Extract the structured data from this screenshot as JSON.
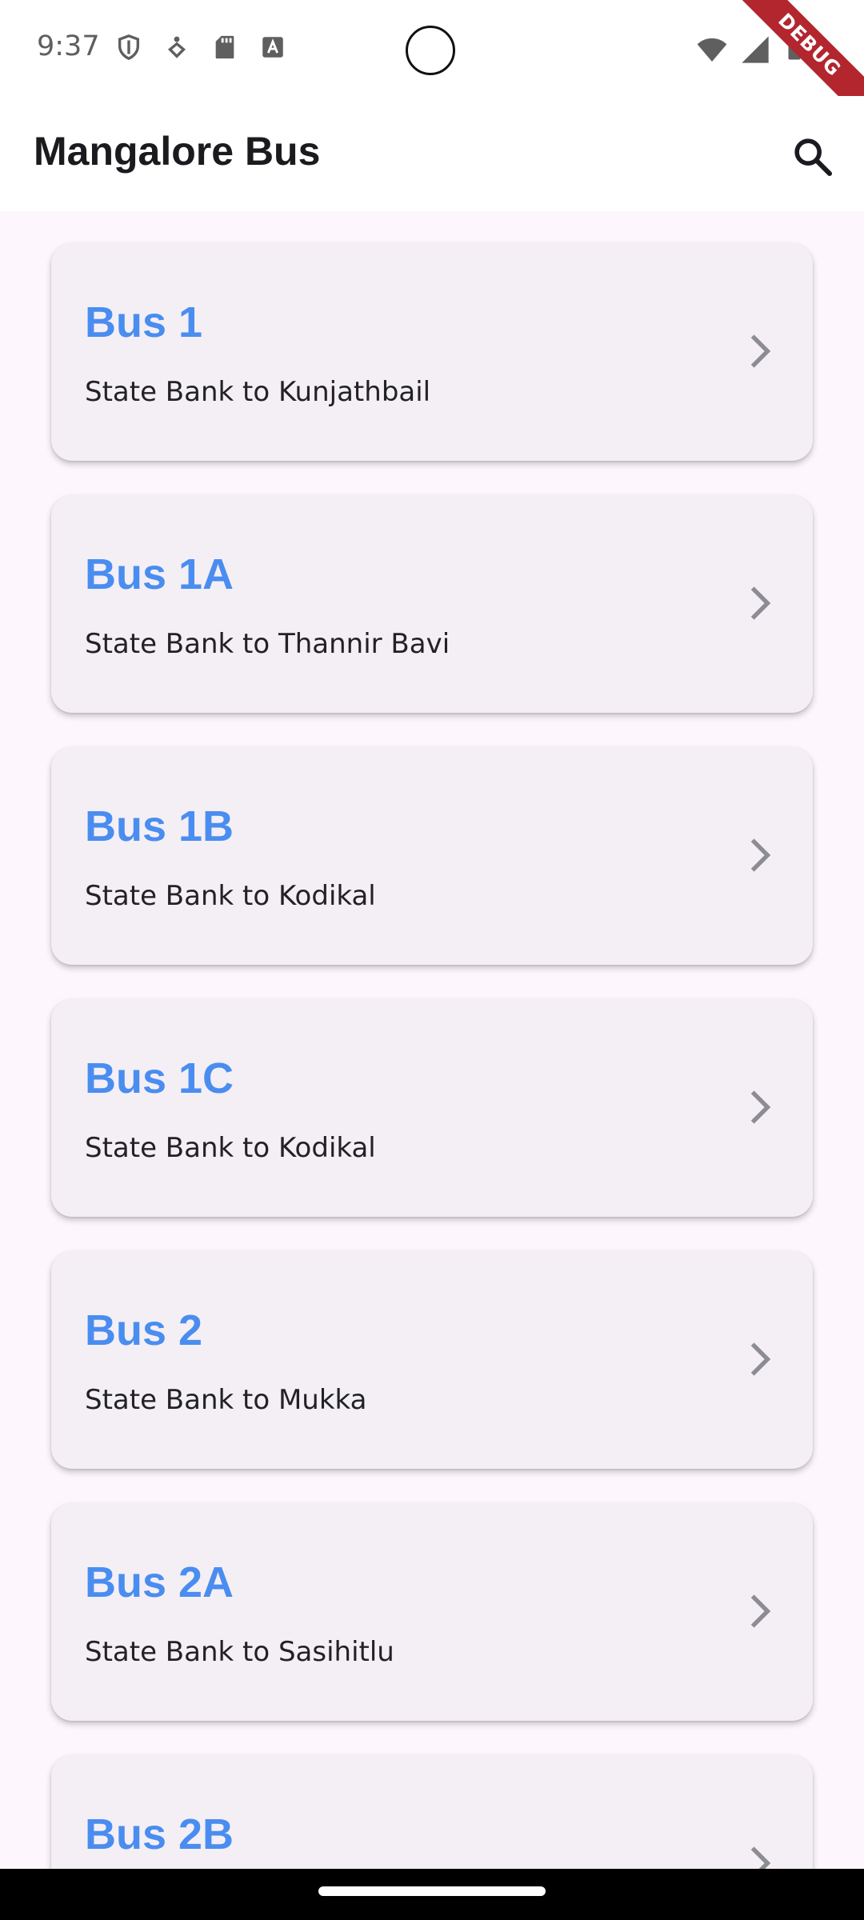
{
  "status_bar": {
    "time": "9:37",
    "debug_label": "DEBUG"
  },
  "app_bar": {
    "title": "Mangalore Bus"
  },
  "colors": {
    "accent": "#4a8df0",
    "card_background": "#f4eff5",
    "page_background": "#fdf7fd",
    "debug_banner": "#b3262e"
  },
  "routes": [
    {
      "name": "Bus 1",
      "route": "State Bank to Kunjathbail"
    },
    {
      "name": "Bus 1A",
      "route": "State Bank to Thannir Bavi"
    },
    {
      "name": "Bus 1B",
      "route": "State Bank to Kodikal"
    },
    {
      "name": "Bus 1C",
      "route": "State Bank to Kodikal"
    },
    {
      "name": "Bus 2",
      "route": "State Bank to Mukka"
    },
    {
      "name": "Bus 2A",
      "route": "State Bank to Sasihitlu"
    },
    {
      "name": "Bus 2B",
      "route": ""
    }
  ],
  "icons": {
    "search": "search-icon",
    "chevron": "chevron-right-icon"
  }
}
